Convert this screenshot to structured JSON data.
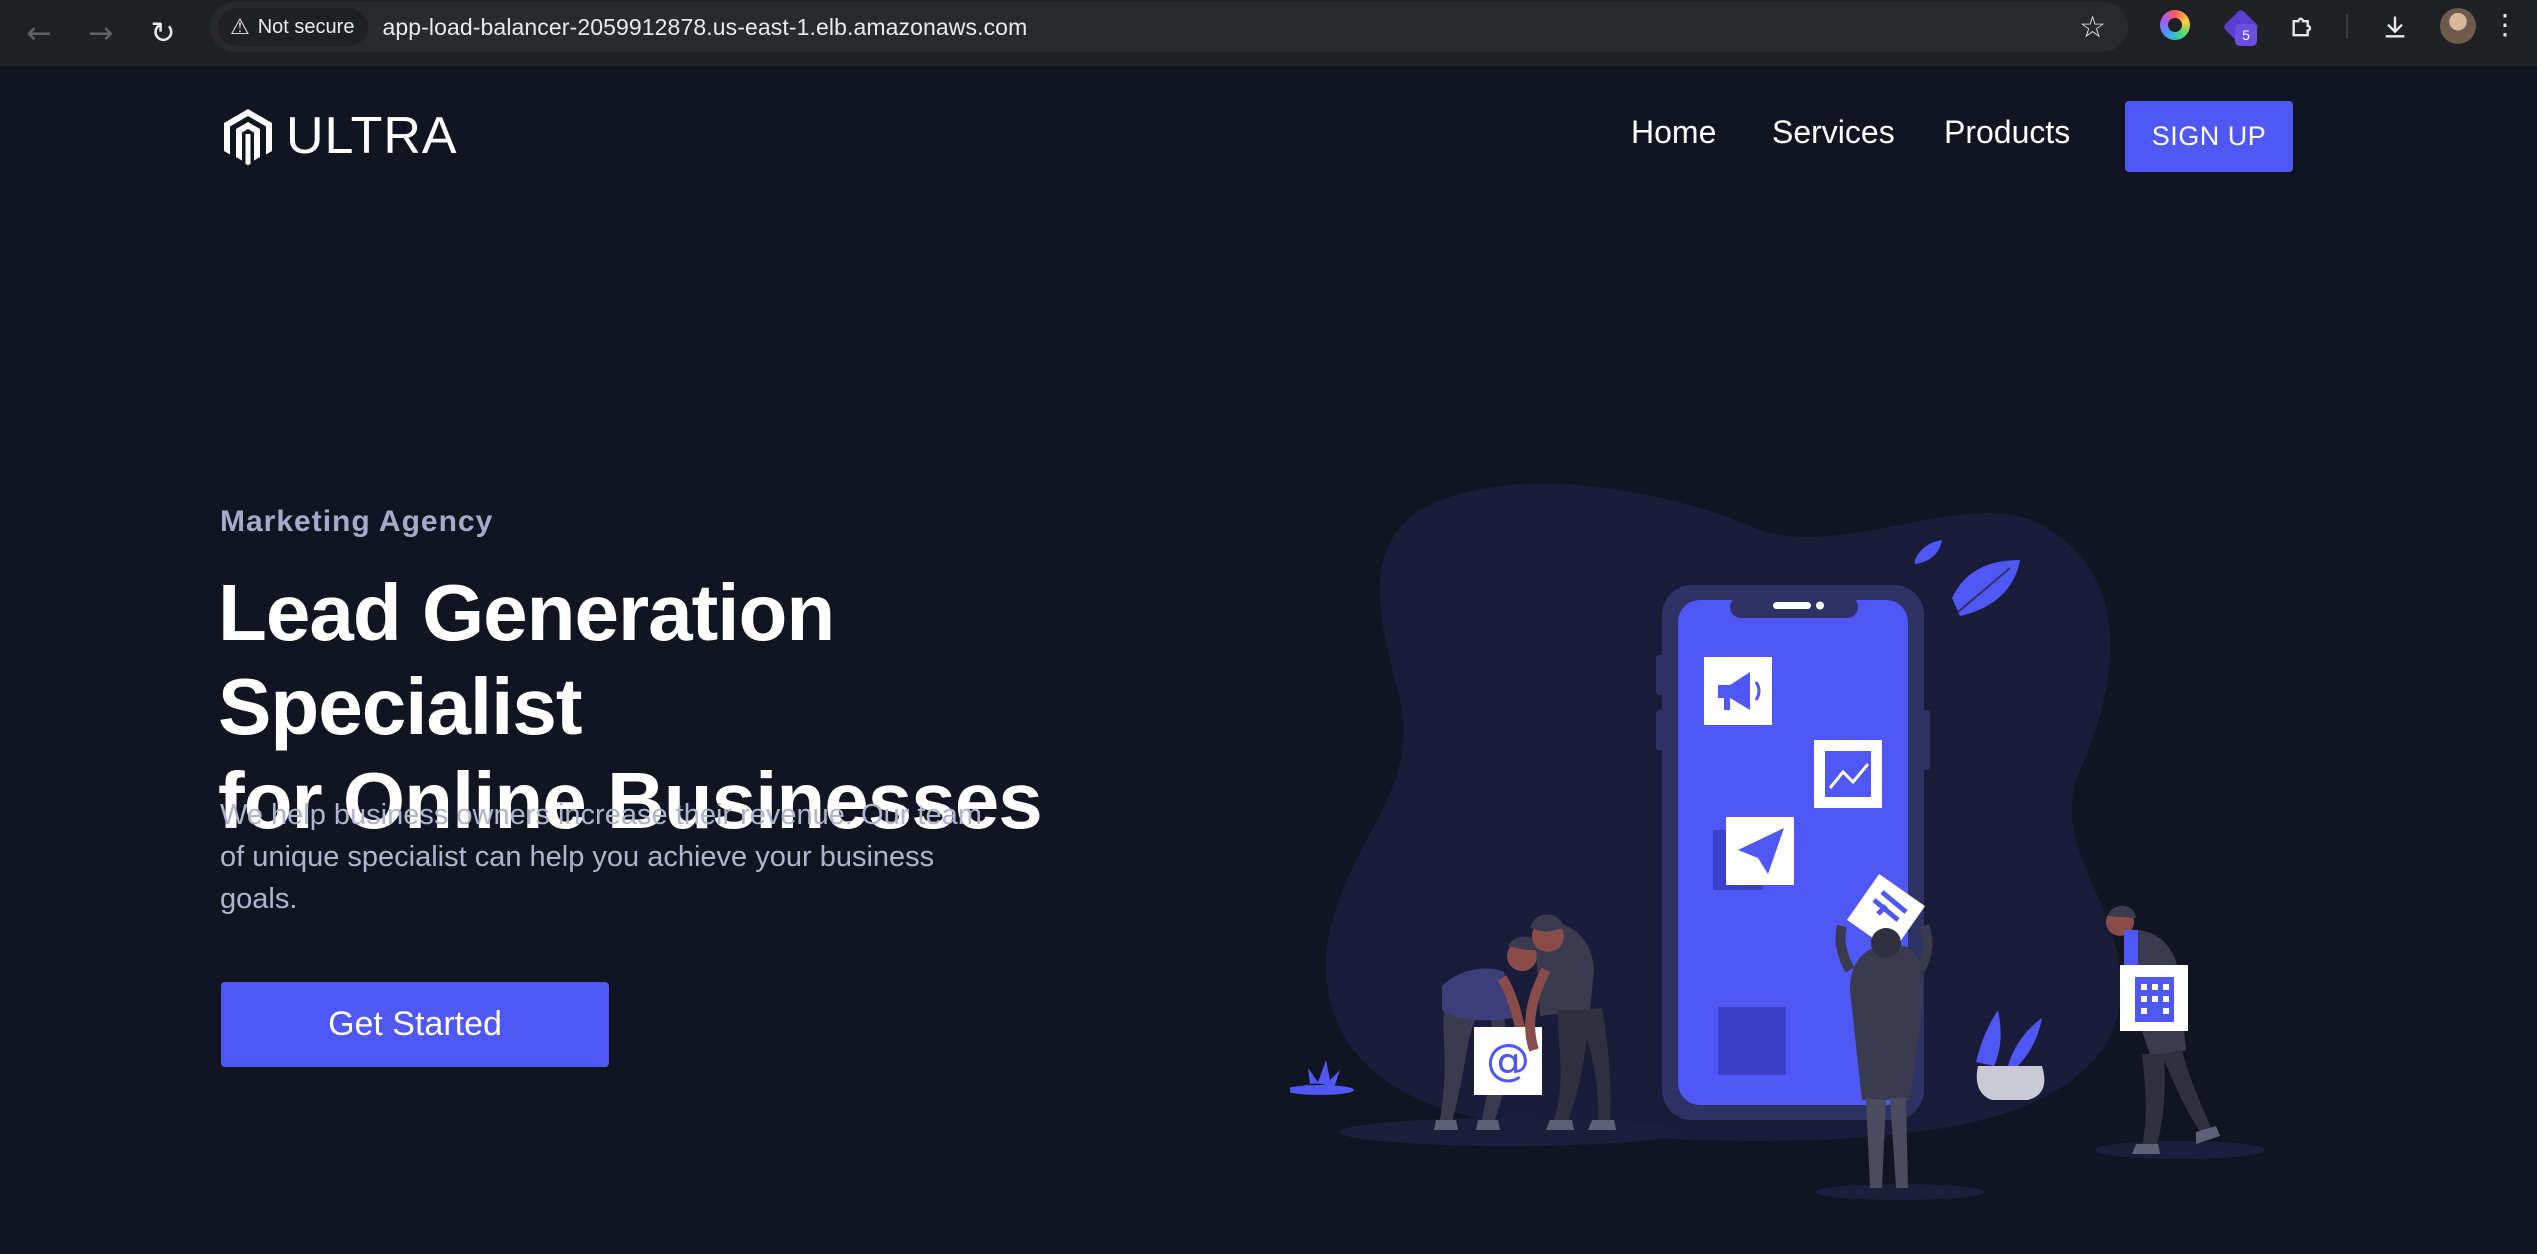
{
  "browser": {
    "security_label": "Not secure",
    "url": "app-load-balancer-2059912878.us-east-1.elb.amazonaws.com",
    "extension_badge": "5",
    "icons": [
      "back-arrow-icon",
      "forward-arrow-icon",
      "reload-icon",
      "warning-icon",
      "star-icon",
      "color-wheel-icon",
      "cube-stack-icon",
      "puzzle-icon",
      "download-icon",
      "avatar"
    ]
  },
  "site": {
    "brand": "ULTRA",
    "nav": [
      "Home",
      "Services",
      "Products"
    ],
    "signup_label": "SIGN UP",
    "colors": {
      "background": "#111522",
      "accent": "#4f57f4"
    }
  },
  "hero": {
    "eyebrow": "Marketing Agency",
    "title_line1": "Lead Generation Specialist",
    "title_line2": "for Online Businesses",
    "description": "We help business owners increase their revenue. Our team of unique specialist can help you achieve your business goals.",
    "cta_label": "Get Started"
  }
}
